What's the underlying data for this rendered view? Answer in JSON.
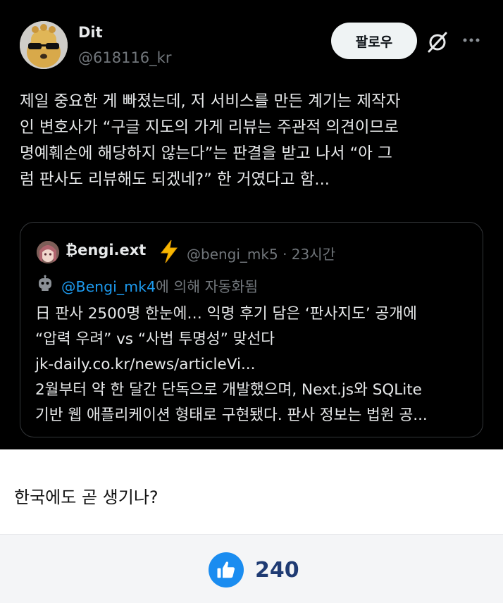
{
  "tweet": {
    "display_name": "Dit",
    "handle": "@618116_kr",
    "follow_label": "팔로우",
    "text_lines": [
      "제일 중요한 게 빠졌는데, 저 서비스를 만든 계기는 제작자",
      "인 변호사가 “구글 지도의 가게 리뷰는 주관적 의견이므로",
      "명예훼손에 해당하지 않는다”는 판결을 받고 나서 “아 그",
      "럼 판사도 리뷰해도 되겠네?” 한 거였다고 함..."
    ],
    "icons": {
      "grok": "grok-slash-icon",
      "more": "more-dots-icon"
    }
  },
  "quote": {
    "name": "₿engi.ext",
    "badge_icon": "lightning-bolt-icon",
    "handle_time": "@bengi_mk5 · 23시간",
    "automated_mention": "@Bengi_mk4",
    "automated_suffix": "에 의해 자동화됨",
    "body_lines": [
      "日 판사 2500명 한눈에… 익명 후기 담은 ‘판사지도’ 공개에",
      "“압력 우려” vs “사법 투명성” 맞선다",
      "jk-daily.co.kr/news/articleVi...",
      "2월부터 약 한 달간 단독으로 개발했으며, Next.js와 SQLite",
      "기반 웹 애플리케이션 형태로 구현됐다. 판사 정보는 법원 공..."
    ]
  },
  "post": {
    "text": "한국에도 곧 생기나?"
  },
  "footer": {
    "like_icon": "thumbs-up-icon",
    "like_count": "240"
  },
  "colors": {
    "tweet_bg": "#000000",
    "link_blue": "#1d9bf0",
    "like_blue": "#1a8cf0",
    "count_navy": "#1f3b73"
  }
}
